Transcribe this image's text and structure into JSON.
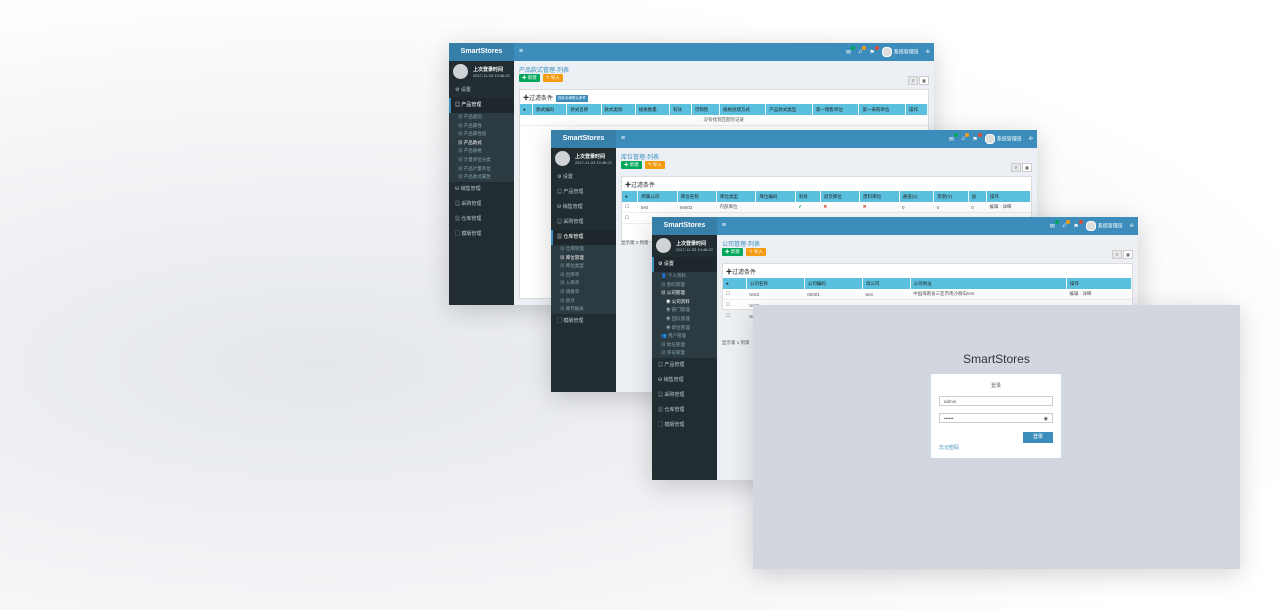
{
  "colors": {
    "topbar": "#3c8dbc",
    "sidebar": "#222d32",
    "table_header": "#5bc0de",
    "success": "#00a65a",
    "warning": "#f39c12"
  },
  "common": {
    "brand": "SmartStores",
    "hamburger": "≡",
    "last_login_label": "上次登录时间",
    "last_login_time": "2017-11-03 13:46:22",
    "admin_name": "系统管理员",
    "btn_new": "✚ 新建",
    "btn_import": "↰ 导入",
    "filter_label": "✚过滤条件",
    "icons": {
      "mail": "envelope-icon",
      "bell": "bell-icon",
      "flag": "flag-icon",
      "share": "share-icon"
    }
  },
  "win1": {
    "breadcrumb": "产品款式管理-列表",
    "filter_badge": "保存全局默认条件",
    "menu": {
      "settings": "设置",
      "product_mgmt": "产品管理",
      "sub": [
        "产品类别",
        "产品属性",
        "产品属性值",
        "产品款式",
        "产品规格",
        "计量单位分类",
        "产品计量单位",
        "产品款式属性"
      ],
      "sales": "销售管理",
      "purchase": "采购管理",
      "warehouse": "仓库管理",
      "basic": "模版管理"
    },
    "columns": [
      "款式编码",
      "款式名称",
      "款式类别",
      "规格数量",
      "有效",
      "可销售",
      "规格创建方式",
      "产品款式类型",
      "第一销售单位",
      "第一采购单位",
      "操作"
    ],
    "empty_text": "没有找到匹配的记录"
  },
  "win2": {
    "breadcrumb": "库位管理-列表",
    "menu": {
      "settings": "设置",
      "product_mgmt": "产品管理",
      "sales": "销售管理",
      "purchase": "采购管理",
      "warehouse": "仓库管理",
      "sub": [
        "仓库管理",
        "库位管理",
        "库位类型",
        "出库单",
        "入库单",
        "调拨单",
        "盘点",
        "库存报表"
      ],
      "basic": "模版管理"
    },
    "columns": [
      "所属公司",
      "库位名称",
      "库位类型",
      "库位编码",
      "有效",
      "退货库位",
      "废料库位",
      "通道(X)",
      "货架(Y)",
      "层",
      "操作"
    ],
    "row": {
      "company": "test",
      "name": "test03",
      "type": "内部库位",
      "code": "",
      "valid": "✔",
      "ret": "✖",
      "scrap": "✖",
      "x": "0",
      "y": "0",
      "z": "0",
      "ops": "编辑 · 详细"
    },
    "footer": "显示第 1 到第"
  },
  "win3": {
    "breadcrumb": "公司管理-列表",
    "menu": {
      "settings": "设置",
      "personal": "个人资料",
      "pwd": "密码管理",
      "company": "公司管理",
      "company_sub": [
        "公司资料",
        "部门管理",
        "团队管理",
        "职位管理"
      ],
      "users": "用户管理",
      "region": "地址管理",
      "seq": "序号管理",
      "product_mgmt": "产品管理",
      "sales": "销售管理",
      "purchase": "采购管理",
      "warehouse": "仓库管理",
      "basic": "模版管理"
    },
    "columns": [
      "公司名称",
      "公司编码",
      "母公司",
      "公司地址",
      "操作"
    ],
    "rows": [
      {
        "name": "test3",
        "code": "00001",
        "parent": "test",
        "addr": "中国海南省三亚市南沙群岛test",
        "ops": "编辑 · 详细"
      },
      {
        "name": "test2",
        "code": "",
        "parent": "",
        "addr": "",
        "ops": ""
      },
      {
        "name": "test",
        "code": "",
        "parent": "",
        "addr": "",
        "ops": ""
      }
    ],
    "footer": "显示第 1 到第"
  },
  "login": {
    "title": "SmartStores",
    "caption": "登录",
    "username": "admin",
    "password": "••••••",
    "submit": "登录",
    "forgot": "忘记密码"
  }
}
